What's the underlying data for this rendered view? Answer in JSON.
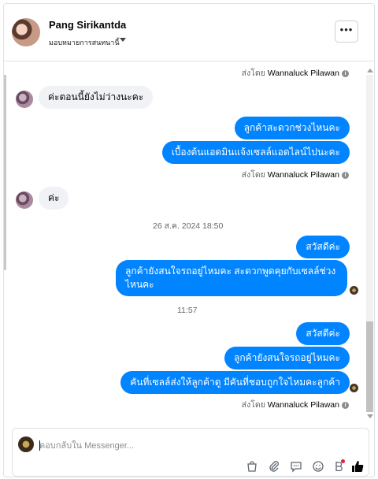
{
  "header": {
    "name": "Pang Sirikantda",
    "subtitle": "มอบหมายการสนทนานี้",
    "more_label": "•••"
  },
  "sent_by_prefix": "ส่งโดย",
  "sent_by_name": "Wannaluck Pilawan",
  "info_label": "i",
  "messages": {
    "in_1": "ค่ะตอนนี้ยังไม่ว่างนะคะ",
    "out_1": "ลูกค้าสะดวกช่วงไหนคะ",
    "out_2": "เบื้องต้นแอดมินแจ้งเซลล์แอดไลน์ไปนะคะ",
    "in_2": "ค่ะ",
    "timestamp_1": "26 ส.ค. 2024 18:50",
    "out_3": "สวัสดีค่ะ",
    "out_4": "ลูกค้ายังสนใจรถอยู่ไหมคะ สะดวกพูดคุยกับเซลล์ช่วงไหนคะ",
    "timestamp_2": "11:57",
    "out_5": "สวัสดีค่ะ",
    "out_6": "ลูกค้ายังสนใจรถอยู่ไหมคะ",
    "out_7": "คันที่เซลล์ส่งให้ลูกค้าดู มีคันที่ชอบถูกใจไหมคะลูกค้า"
  },
  "composer": {
    "placeholder": "ตอบกลับใน Messenger..."
  },
  "icons": [
    "shop-icon",
    "attachment-icon",
    "saved-reply-icon",
    "emoji-icon",
    "payment-icon",
    "like-icon"
  ],
  "colors": {
    "outgoing_bubble": "#0084ff",
    "incoming_bubble": "#f0f2f5",
    "accent": "#0084ff"
  }
}
